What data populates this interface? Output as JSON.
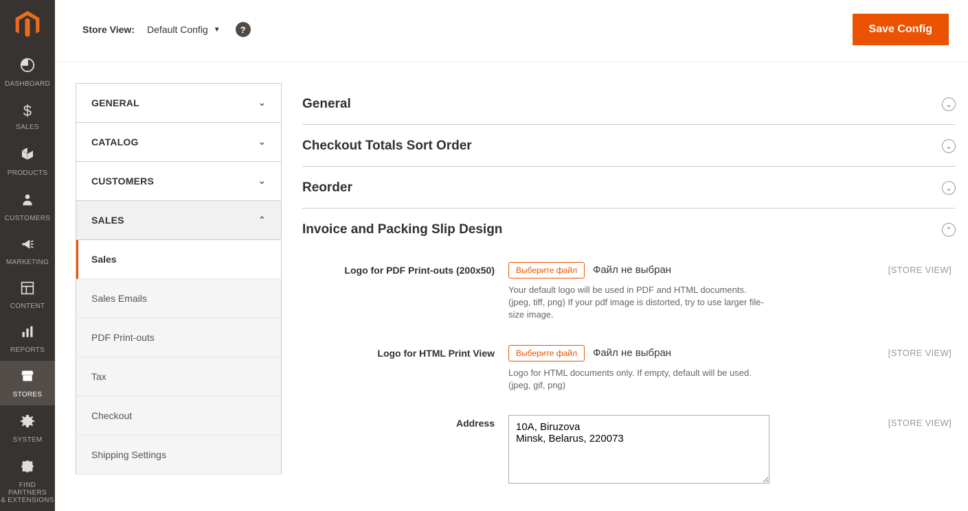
{
  "nav": {
    "items": [
      {
        "label": "DASHBOARD"
      },
      {
        "label": "SALES"
      },
      {
        "label": "PRODUCTS"
      },
      {
        "label": "CUSTOMERS"
      },
      {
        "label": "MARKETING"
      },
      {
        "label": "CONTENT"
      },
      {
        "label": "REPORTS"
      },
      {
        "label": "STORES"
      },
      {
        "label": "SYSTEM"
      },
      {
        "label": "FIND PARTNERS\n& EXTENSIONS"
      }
    ]
  },
  "topbar": {
    "store_view_label": "Store View:",
    "store_view_value": "Default Config",
    "save_label": "Save Config"
  },
  "config_tabs": {
    "groups": [
      {
        "label": "GENERAL"
      },
      {
        "label": "CATALOG"
      },
      {
        "label": "CUSTOMERS"
      },
      {
        "label": "SALES"
      }
    ],
    "sales_subtabs": [
      {
        "label": "Sales"
      },
      {
        "label": "Sales Emails"
      },
      {
        "label": "PDF Print-outs"
      },
      {
        "label": "Tax"
      },
      {
        "label": "Checkout"
      },
      {
        "label": "Shipping Settings"
      }
    ]
  },
  "sections": {
    "general": "General",
    "checkout_totals": "Checkout Totals Sort Order",
    "reorder": "Reorder",
    "invoice": "Invoice and Packing Slip Design"
  },
  "fields": {
    "logo_pdf": {
      "label": "Logo for PDF Print-outs (200x50)",
      "file_btn": "Выберите файл",
      "file_status": "Файл не выбран",
      "hint": "Your default logo will be used in PDF and HTML documents. (jpeg, tiff, png) If your pdf image is distorted, try to use larger file-size image.",
      "scope": "[STORE VIEW]"
    },
    "logo_html": {
      "label": "Logo for HTML Print View",
      "file_btn": "Выберите файл",
      "file_status": "Файл не выбран",
      "hint": "Logo for HTML documents only. If empty, default will be used. (jpeg, gif, png)",
      "scope": "[STORE VIEW]"
    },
    "address": {
      "label": "Address",
      "value": "10A, Biruzova\nMinsk, Belarus, 220073",
      "scope": "[STORE VIEW]"
    }
  }
}
